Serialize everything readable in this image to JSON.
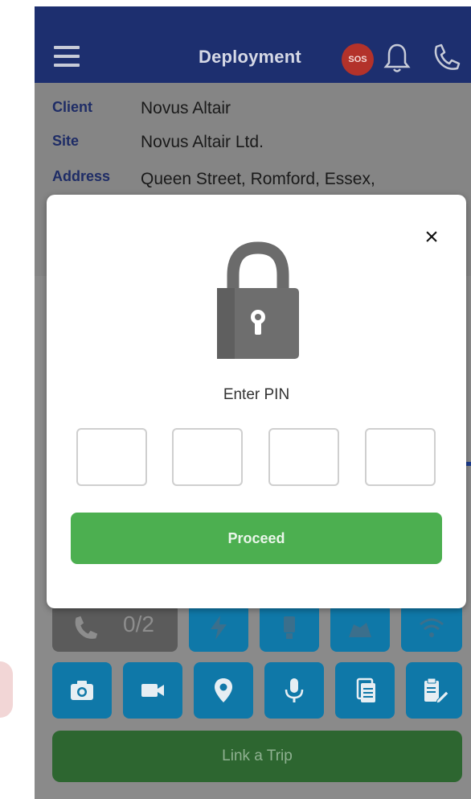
{
  "header": {
    "title": "Deployment",
    "sos_label": "SOS",
    "icons": [
      "hamburger-menu-icon",
      "bell-icon",
      "phone-icon"
    ]
  },
  "info": {
    "client_label": "Client",
    "client_value": "Novus Altair",
    "site_label": "Site",
    "site_value": "Novus Altair Ltd.",
    "address_label": "Address",
    "address_value": "Queen Street, Romford, Essex,"
  },
  "call_counter": "0/2",
  "actions_row1": [
    "flash-icon",
    "flashlight-icon",
    "map-icon",
    "wifi-icon"
  ],
  "actions_row2": [
    "camera-icon",
    "video-icon",
    "location-pin-icon",
    "microphone-icon",
    "documents-icon",
    "clipboard-edit-icon"
  ],
  "link_trip_label": "Link a Trip",
  "modal": {
    "pin_label": "Enter PIN",
    "pin_values": [
      "",
      "",
      "",
      ""
    ],
    "proceed_label": "Proceed",
    "close_symbol": "×"
  },
  "colors": {
    "header_bg": "#1d2f6f",
    "action_blue": "#0f78a8",
    "proceed_green": "#4caf50",
    "link_trip_green": "#2d6630",
    "sos_red": "#b3322a"
  }
}
